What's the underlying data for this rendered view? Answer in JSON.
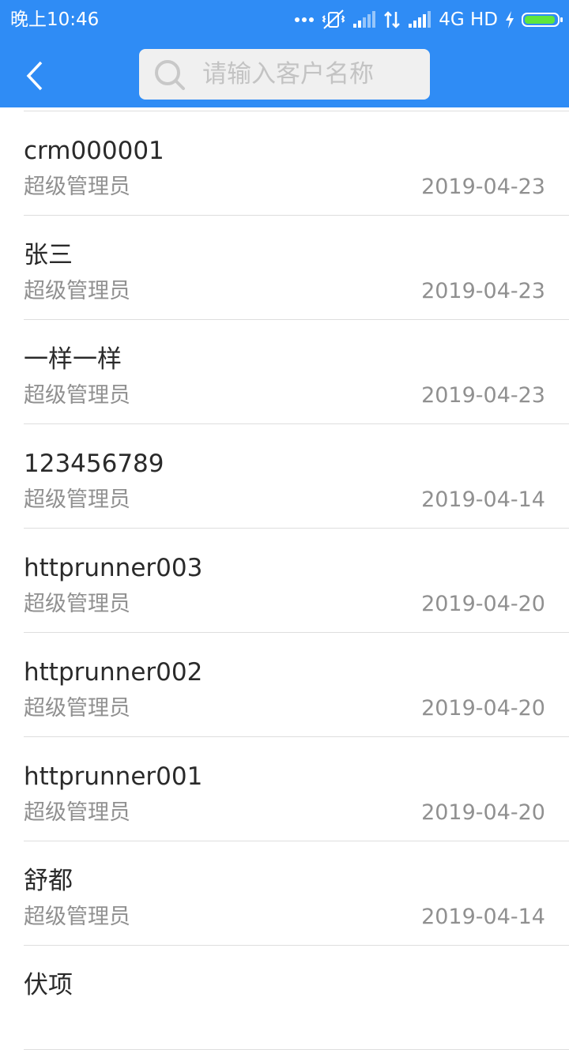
{
  "status_bar": {
    "time": "晚上10:46",
    "network": "4G HD",
    "icons": [
      "more-dots-icon",
      "vibrate-off-icon",
      "signal-icon",
      "data-transfer-icon",
      "signal-icon",
      "charging-icon",
      "battery-icon"
    ]
  },
  "colors": {
    "header": "#2f8cf5",
    "battery_fill": "#5ee63c",
    "divider": "#dedede"
  },
  "header": {
    "back_icon": "chevron-left-icon",
    "search": {
      "placeholder": "请输入客户名称",
      "value": "",
      "icon": "search-icon"
    }
  },
  "customers": [
    {
      "name": "crm000001",
      "owner": "超级管理员",
      "date": "2019-04-23"
    },
    {
      "name": "张三",
      "owner": "超级管理员",
      "date": "2019-04-23"
    },
    {
      "name": "一样一样",
      "owner": "超级管理员",
      "date": "2019-04-23"
    },
    {
      "name": "123456789",
      "owner": "超级管理员",
      "date": "2019-04-14"
    },
    {
      "name": "httprunner003",
      "owner": "超级管理员",
      "date": "2019-04-20"
    },
    {
      "name": "httprunner002",
      "owner": "超级管理员",
      "date": "2019-04-20"
    },
    {
      "name": "httprunner001",
      "owner": "超级管理员",
      "date": "2019-04-20"
    },
    {
      "name": "舒都",
      "owner": "超级管理员",
      "date": "2019-04-14"
    },
    {
      "name": "伏项",
      "owner": "",
      "date": ""
    }
  ]
}
